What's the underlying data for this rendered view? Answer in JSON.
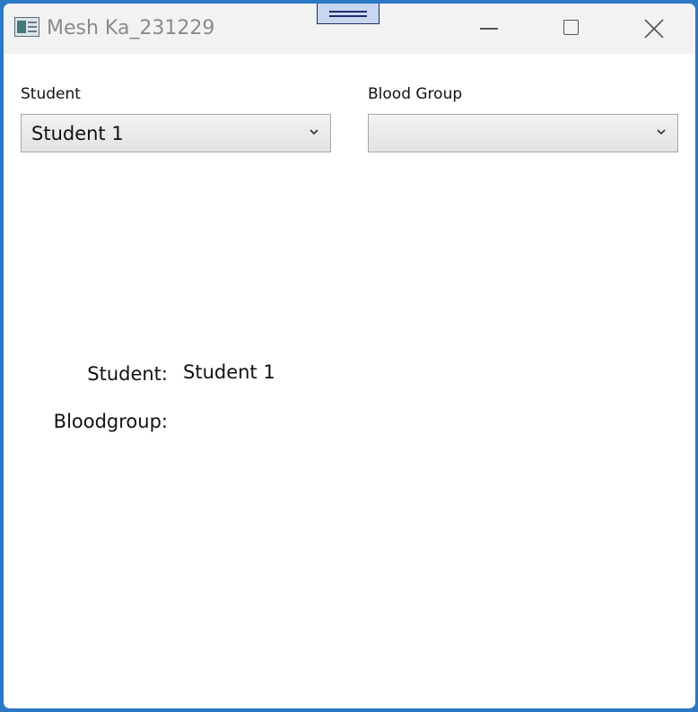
{
  "window": {
    "title": "Mesh Ka_231229"
  },
  "icons": {
    "app": "app-icon",
    "drag": "drag-handle-icon",
    "minimize": "minimize-icon",
    "maximize": "maximize-icon",
    "close": "close-icon",
    "dropdown": "chevron-down-icon"
  },
  "form": {
    "student_label": "Student",
    "student_selected": "Student 1",
    "bloodgroup_label": "Blood Group",
    "bloodgroup_selected": ""
  },
  "summary": {
    "student_label": "Student:",
    "student_value": "Student 1",
    "bloodgroup_label": "Bloodgroup:",
    "bloodgroup_value": ""
  },
  "colors": {
    "window_frame": "#2b78c5",
    "titlebar_bg": "#f2f2f2",
    "drag_handle_fill": "#c9d6ef",
    "drag_handle_border": "#1f2f6a"
  }
}
